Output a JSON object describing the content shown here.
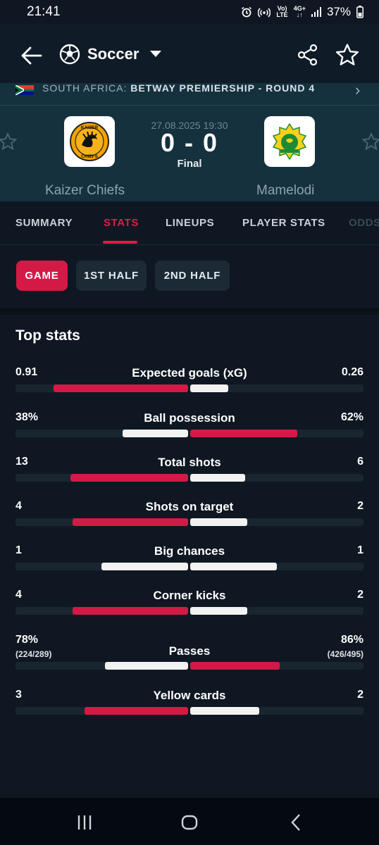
{
  "status_bar": {
    "time": "21:41",
    "network_top": "Vo)",
    "network_bottom": "LTE",
    "data_top": "4G+",
    "battery": "37%",
    "icons": [
      "alarm-icon",
      "hotspot-icon",
      "volte-icon",
      "signal-icon",
      "battery-icon"
    ]
  },
  "header": {
    "title": "Soccer",
    "icons": [
      "back-arrow-icon",
      "soccer-ball-icon",
      "chevron-down-icon",
      "share-icon",
      "star-icon"
    ]
  },
  "match": {
    "league_prefix": "SOUTH AFRICA:",
    "league_name": "BETWAY PREMIERSHIP - ROUND 4",
    "date": "27.08.2025 19:30",
    "score": "0 - 0",
    "status": "Final",
    "home_team": "Kaizer Chiefs",
    "away_team": "Mamelodi",
    "home_logo_text": "KAIZER CHIEFS",
    "away_logo_text": "MAMELODI SUNDOWNS"
  },
  "tabs": [
    {
      "label": "SUMMARY",
      "active": false
    },
    {
      "label": "STATS",
      "active": true
    },
    {
      "label": "LINEUPS",
      "active": false
    },
    {
      "label": "PLAYER STATS",
      "active": false
    },
    {
      "label": "ODDS",
      "active": false
    }
  ],
  "periods": [
    {
      "label": "GAME",
      "active": true
    },
    {
      "label": "1ST HALF",
      "active": false
    },
    {
      "label": "2ND HALF",
      "active": false
    }
  ],
  "section_title": "Top stats",
  "colors": {
    "accent": "#d31a46",
    "home_bar": "#d31a46",
    "away_bar": "#f2f2f2",
    "background": "#0f1722"
  },
  "stats": [
    {
      "label": "Expected goals (xG)",
      "home": "0.91",
      "away": "0.26",
      "home_share": 0.78,
      "away_share": 0.22,
      "leader": "home"
    },
    {
      "label": "Ball possession",
      "home": "38%",
      "away": "62%",
      "home_share": 0.38,
      "away_share": 0.62,
      "leader": "away"
    },
    {
      "label": "Total shots",
      "home": "13",
      "away": "6",
      "home_share": 0.68,
      "away_share": 0.32,
      "leader": "home"
    },
    {
      "label": "Shots on target",
      "home": "4",
      "away": "2",
      "home_share": 0.67,
      "away_share": 0.33,
      "leader": "home"
    },
    {
      "label": "Big chances",
      "home": "1",
      "away": "1",
      "home_share": 0.5,
      "away_share": 0.5,
      "leader": "none"
    },
    {
      "label": "Corner kicks",
      "home": "4",
      "away": "2",
      "home_share": 0.67,
      "away_share": 0.33,
      "leader": "home"
    },
    {
      "label": "Passes",
      "home": "78%",
      "away": "86%",
      "home_sub": "(224/289)",
      "away_sub": "(426/495)",
      "home_share": 0.48,
      "away_share": 0.52,
      "leader": "away"
    },
    {
      "label": "Yellow cards",
      "home": "3",
      "away": "2",
      "home_share": 0.6,
      "away_share": 0.4,
      "leader": "home"
    }
  ],
  "nav": {
    "icons": [
      "recent-apps-icon",
      "home-icon",
      "back-icon"
    ]
  }
}
